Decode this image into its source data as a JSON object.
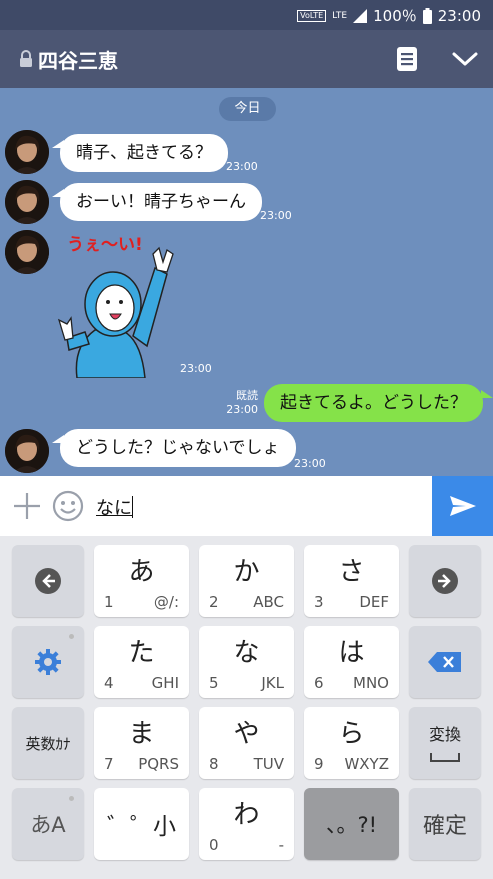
{
  "status": {
    "volte": "VoLTE",
    "lte": "LTE",
    "battery": "100％",
    "time": "23:00"
  },
  "header": {
    "title": "四谷三恵"
  },
  "chat": {
    "date_label": "今日",
    "messages": [
      {
        "side": "left",
        "text": "晴子、起きてる？",
        "time": "23:00"
      },
      {
        "side": "left",
        "text": "おーい！晴子ちゃーん",
        "time": "23:00"
      },
      {
        "side": "left",
        "sticker": true,
        "sticker_text": "うぇ〜い!",
        "time": "23:00"
      },
      {
        "side": "right",
        "text": "起きてるよ。どうした？",
        "read": "既読",
        "time": "23:00"
      },
      {
        "side": "left",
        "text": "どうした？じゃないでしょ",
        "time": "23:00"
      }
    ]
  },
  "input": {
    "text": "なに"
  },
  "keyboard": {
    "rows": [
      [
        {
          "main": "あ",
          "sub_l": "1",
          "sub_r": "@/:"
        },
        {
          "main": "か",
          "sub_l": "2",
          "sub_r": "ABC"
        },
        {
          "main": "さ",
          "sub_l": "3",
          "sub_r": "DEF"
        }
      ],
      [
        {
          "main": "た",
          "sub_l": "4",
          "sub_r": "GHI"
        },
        {
          "main": "な",
          "sub_l": "5",
          "sub_r": "JKL"
        },
        {
          "main": "は",
          "sub_l": "6",
          "sub_r": "MNO"
        }
      ],
      [
        {
          "main": "ま",
          "sub_l": "7",
          "sub_r": "PQRS"
        },
        {
          "main": "や",
          "sub_l": "8",
          "sub_r": "TUV"
        },
        {
          "main": "ら",
          "sub_l": "9",
          "sub_r": "WXYZ"
        }
      ],
      [
        {
          "main": "゛゜小"
        },
        {
          "main": "わ",
          "sub_l": "0",
          "sub_r": "-"
        },
        {
          "main": "、。?!"
        }
      ]
    ],
    "alpha_label": "英数ｶﾅ",
    "kana_label": "あA",
    "convert_label": "変換",
    "confirm_label": "確定"
  },
  "colors": {
    "header": "#4c5673",
    "chat_bg": "#6e8fbd",
    "mine_bubble": "#85e249",
    "send": "#3b8ae8"
  }
}
